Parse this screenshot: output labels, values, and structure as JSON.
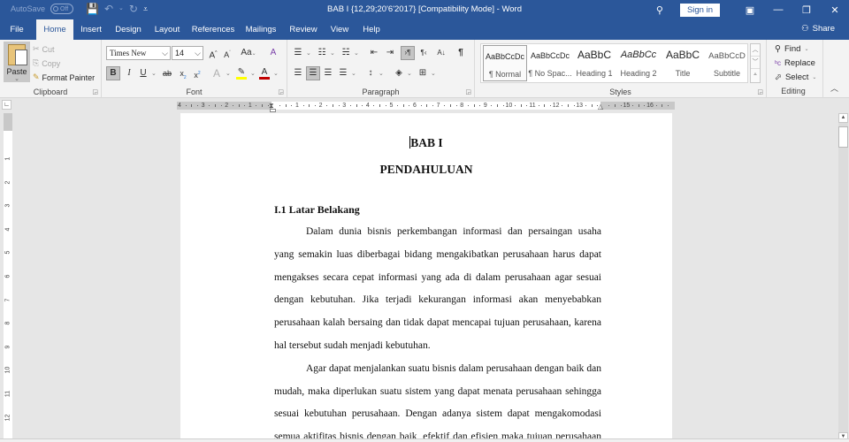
{
  "window": {
    "title": "BAB I {12,29;20'6'2017} [Compatibility Mode]  -  Word",
    "autosave_label": "AutoSave",
    "autosave_state": "Off",
    "sign_in": "Sign in",
    "icons": {
      "save": "💾",
      "undo": "↶",
      "redo": "↻",
      "customize": "⩡",
      "search": "⚲",
      "ribbon_display": "▣",
      "minimize": "—",
      "restore": "❐",
      "close": "✕"
    }
  },
  "tabs": [
    {
      "label": "File"
    },
    {
      "label": "Home",
      "active": true
    },
    {
      "label": "Insert"
    },
    {
      "label": "Design"
    },
    {
      "label": "Layout"
    },
    {
      "label": "References"
    },
    {
      "label": "Mailings"
    },
    {
      "label": "Review"
    },
    {
      "label": "View"
    },
    {
      "label": "Help"
    }
  ],
  "share_label": "Share",
  "ribbon": {
    "clipboard": {
      "label": "Clipboard",
      "paste": "Paste",
      "cut": "Cut",
      "copy": "Copy",
      "format_painter": "Format Painter"
    },
    "font": {
      "label": "Font",
      "font_name": "Times New Roman",
      "font_size": "14",
      "bold_active": true,
      "text_highlight_color": "#ffff00",
      "font_color": "#c00000"
    },
    "paragraph": {
      "label": "Paragraph",
      "alignment": "center",
      "ltr_active": true
    },
    "styles": {
      "label": "Styles",
      "items": [
        {
          "sample": "AaBbCcDc",
          "name": "¶ Normal",
          "selected": true
        },
        {
          "sample": "AaBbCcDc",
          "name": "¶ No Spac..."
        },
        {
          "sample": "AaBbC",
          "name": "Heading 1"
        },
        {
          "sample": "AaBbCc",
          "name": "Heading 2"
        },
        {
          "sample": "AaBbC",
          "name": "Title"
        },
        {
          "sample": "AaBbCcD",
          "name": "Subtitle"
        }
      ]
    },
    "editing": {
      "label": "Editing",
      "find": "Find",
      "replace": "Replace",
      "select": "Select"
    }
  },
  "ruler": {
    "h_labels": [
      "4",
      "3",
      "2",
      "1",
      "",
      "1",
      "2",
      "3",
      "4",
      "5",
      "6",
      "7",
      "8",
      "9",
      "10",
      "11",
      "12",
      "13",
      "",
      "15",
      "16"
    ],
    "v_labels": [
      "1",
      "2",
      "3",
      "4",
      "5",
      "6",
      "7",
      "8",
      "9",
      "10",
      "11",
      "12"
    ]
  },
  "document": {
    "chapter": "BAB I",
    "chapter_title": "PENDAHULUAN",
    "section_heading": "I.1 Latar Belakang",
    "lines": [
      {
        "text": "Dalam dunia bisnis perkembangan informasi dan persaingan usaha",
        "first": true
      },
      {
        "text": "yang semakin luas diberbagai bidang mengakibatkan perusahaan harus dapat"
      },
      {
        "text": "mengakses secara cepat informasi yang ada di dalam perusahaan agar sesuai"
      },
      {
        "text": "dengan kebutuhan. Jika terjadi kekurangan informasi akan menyebabkan"
      },
      {
        "text": "perusahaan kalah bersaing dan tidak dapat mencapai tujuan perusahaan, karena"
      },
      {
        "text": "hal tersebut sudah menjadi kebutuhan.",
        "last": true
      },
      {
        "text": "Agar dapat menjalankan suatu bisnis dalam perusahaan dengan baik dan",
        "first": true
      },
      {
        "text": "mudah, maka diperlukan suatu sistem yang dapat menata perusahaan sehingga"
      },
      {
        "text": "sesuai kebutuhan perusahaan. Dengan adanya sistem dapat mengakomodasi"
      },
      {
        "text": "semua aktifitas bisnis dengan baik, efektif dan efisien maka tujuan perusahaan"
      }
    ]
  }
}
